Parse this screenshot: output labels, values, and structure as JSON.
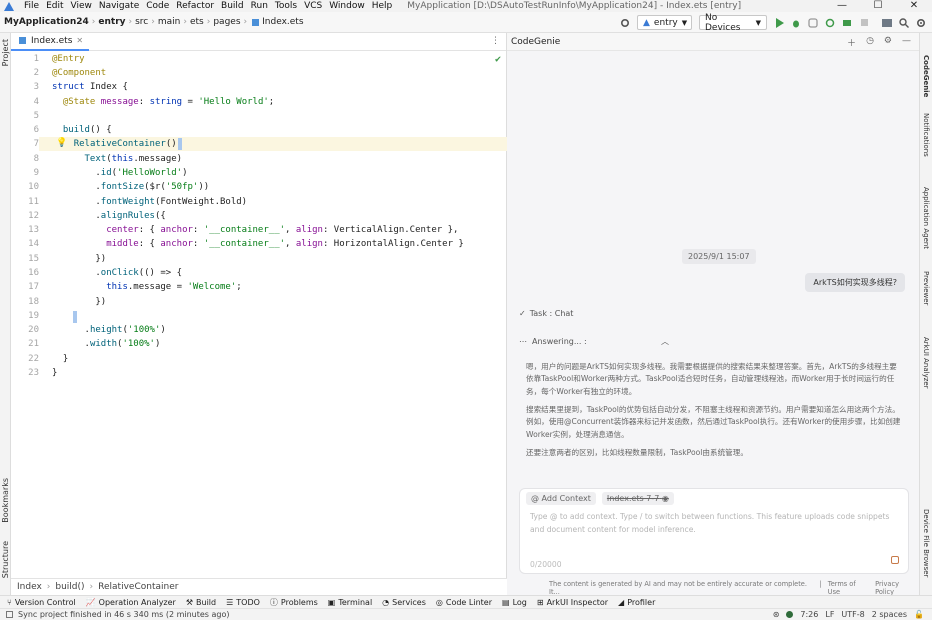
{
  "titlebar": {
    "menu": [
      "File",
      "Edit",
      "View",
      "Navigate",
      "Code",
      "Refactor",
      "Build",
      "Run",
      "Tools",
      "VCS",
      "Window",
      "Help"
    ],
    "title": "MyApplication [D:\\DSAutoTestRunInfo\\MyApplication24] - Index.ets [entry]",
    "min": "—",
    "max": "☐",
    "close": "✕"
  },
  "toolbar": {
    "crumbs": [
      "MyApplication24",
      "entry",
      "src",
      "main",
      "ets",
      "pages",
      "Index.ets"
    ],
    "module_select": "entry",
    "device_select": "No Devices"
  },
  "left_strip": {
    "project": "Project",
    "bookmarks": "Bookmarks",
    "structure": "Structure"
  },
  "editor": {
    "tab": "Index.ets",
    "lines": [
      "1",
      "2",
      "3",
      "4",
      "5",
      "6",
      "7",
      "8",
      "9",
      "10",
      "11",
      "12",
      "13",
      "14",
      "15",
      "16",
      "17",
      "18",
      "19",
      "20",
      "21",
      "22",
      "23"
    ],
    "breadcrumb": [
      "Index",
      "build()",
      "RelativeContainer"
    ]
  },
  "codegenie": {
    "title": "CodeGenie",
    "timestamp": "2025/9/1 15:07",
    "user_msg": "ArkTS如何实现多线程?",
    "task_label": "Task : Chat",
    "answering": "Answering... :",
    "para1": "嗯，用户的问题是ArkTS如何实现多线程。我需要根据提供的搜索结果来整理答案。首先，ArkTS的多线程主要依靠TaskPool和Worker两种方式。TaskPool适合短时任务，自动管理线程池，而Worker用于长时间运行的任务，每个Worker有独立的环境。",
    "para2": "搜索结果里提到，TaskPool的优势包括自动分发，不阻塞主线程和资源节约。用户需要知道怎么用这两个方法。例如，使用@Concurrent装饰器来标记并发函数，然后通过TaskPool执行。还有Worker的使用步骤，比如创建Worker实例，处理消息通信。",
    "para3": "还要注意两者的区别，比如线程数量限制，TaskPool由系统管理。",
    "chip_add": "@ Add Context",
    "chip_file": "Index.ets  7-7",
    "placeholder": "Type @ to add context. Type / to switch between functions. This feature uploads code snippets and document content for model inference.",
    "counter": "0/20000",
    "disclaimer": "The content is generated by AI and may not be entirely accurate or complete. It...",
    "terms": "Terms of Use",
    "privacy": "Privacy Policy"
  },
  "right_strip": [
    "CodeGenie",
    "Notifications",
    "Application Agent",
    "Previewer",
    "ArkUI Analyzer",
    "Device File Browser"
  ],
  "toolwindows": [
    "Version Control",
    "Operation Analyzer",
    "Build",
    "TODO",
    "Problems",
    "Terminal",
    "Services",
    "Code Linter",
    "Log",
    "ArkUI Inspector",
    "Profiler"
  ],
  "statusbar": {
    "message": "Sync project finished in 46 s 340 ms (2 minutes ago)",
    "position": "7:26",
    "line_sep": "LF",
    "encoding": "UTF-8",
    "indent": "2 spaces"
  }
}
